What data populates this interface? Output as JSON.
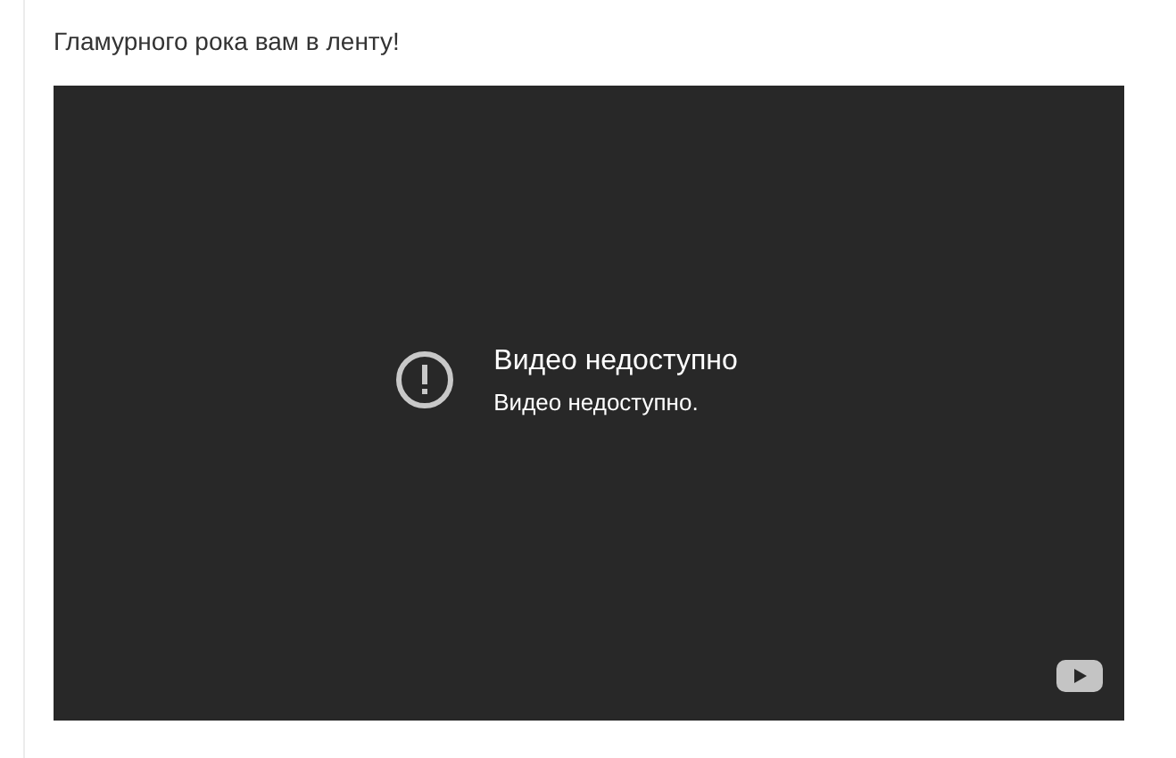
{
  "post": {
    "text": "Гламурного рока вам в ленту!"
  },
  "video": {
    "error_title": "Видео недоступно",
    "error_message": "Видео недоступно."
  }
}
